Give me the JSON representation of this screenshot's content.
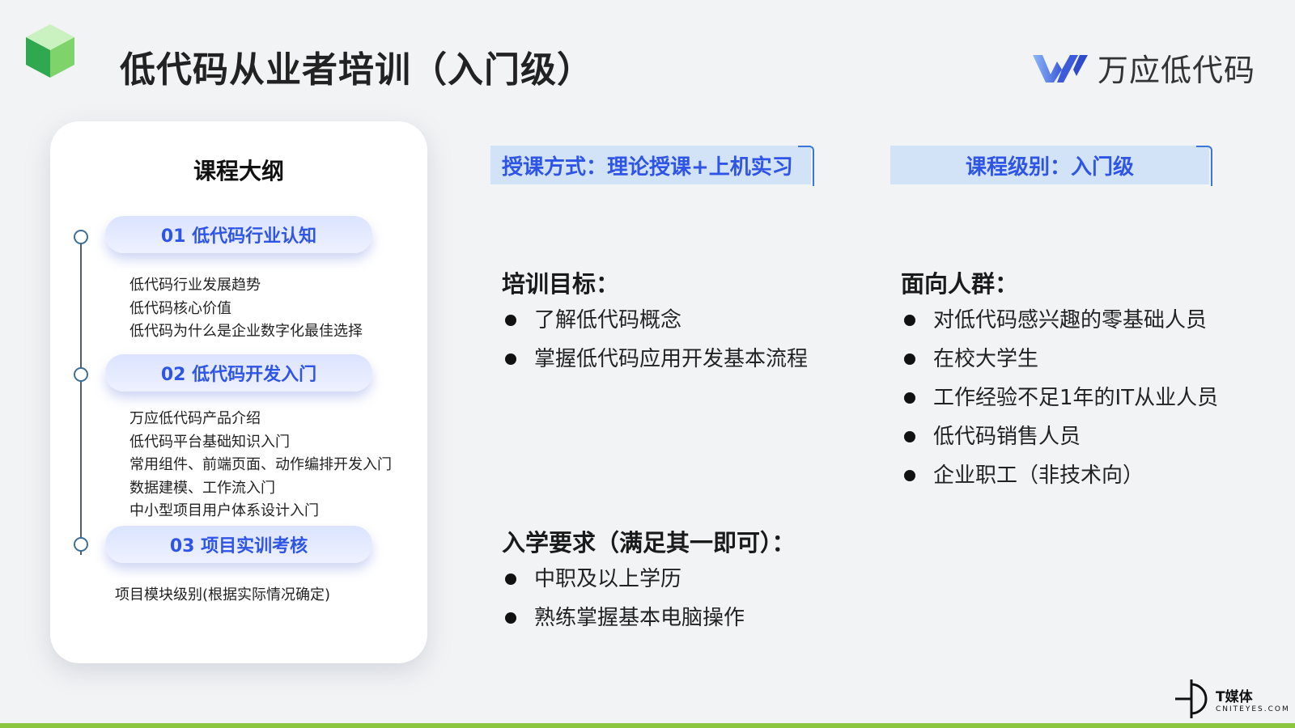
{
  "header": {
    "title": "低代码从业者培训（入门级）",
    "brand_name": "万应低代码",
    "brand_colors": {
      "primary": "#3b5bdb",
      "secondary": "#7aa7f5"
    },
    "cube_icon": "green-cube-icon"
  },
  "outline": {
    "title": "课程大纲",
    "modules": [
      {
        "label": "01 低代码行业认知",
        "items": [
          "低代码行业发展趋势",
          "低代码核心价值",
          "低代码为什么是企业数字化最佳选择"
        ]
      },
      {
        "label": "02 低代码开发入门",
        "items": [
          "万应低代码产品介绍",
          "低代码平台基础知识入门",
          "常用组件、前端页面、动作编排开发入门",
          "数据建模、工作流入门",
          "中小型项目用户体系设计入门"
        ]
      },
      {
        "label": "03 项目实训考核",
        "items": [
          "项目模块级别(根据实际情况确定)"
        ]
      }
    ]
  },
  "tags": {
    "method": "授课方式：理论授课+上机实习",
    "level": "课程级别：入门级"
  },
  "goals": {
    "title": "培训目标：",
    "items": [
      "了解低代码概念",
      "掌握低代码应用开发基本流程"
    ]
  },
  "audience": {
    "title": "面向人群：",
    "items": [
      "对低代码感兴趣的零基础人员",
      "在校大学生",
      "工作经验不足1年的IT从业人员",
      "低代码销售人员",
      "企业职工（非技术向）"
    ]
  },
  "requirements": {
    "title": "入学要求（满足其一即可）：",
    "items": [
      "中职及以上学历",
      "熟练掌握基本电脑操作"
    ]
  },
  "footer": {
    "logo_cn": "T媒体",
    "logo_en": "CNITEYES.COM",
    "accent_bar_color": "#8cc63f"
  }
}
